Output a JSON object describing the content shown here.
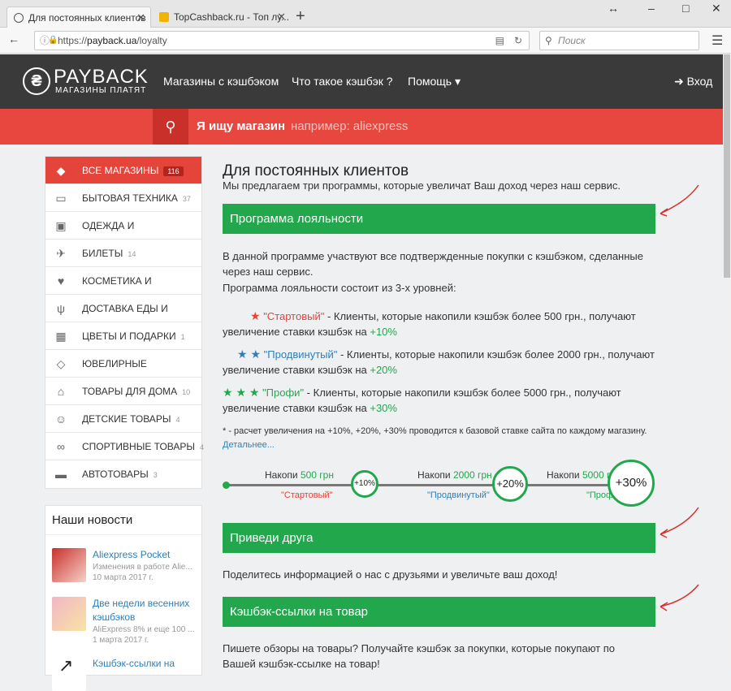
{
  "browser": {
    "tabs": [
      {
        "title": "Для постоянных клиентов",
        "close": "✕"
      },
      {
        "title": "TopCashback.ru - Топ лу...",
        "close": "✕"
      }
    ],
    "new_tab": "+",
    "url_scheme": "https://",
    "url_host": "payback.ua",
    "url_path": "/loyalty",
    "search_placeholder": "Поиск",
    "window_controls": [
      "↔",
      "–",
      "□",
      "✕"
    ]
  },
  "header": {
    "logo_name": "PAYBACK",
    "logo_tagline": "МАГАЗИНЫ ПЛАТЯТ",
    "menu": [
      "Магазины с кэшбэком",
      "Что такое кэшбэк ?",
      "Помощь ▾"
    ],
    "login": "Вход"
  },
  "search": {
    "label": "Я ищу магазин",
    "placeholder": "например: aliexpress"
  },
  "sidebar": {
    "categories": [
      {
        "label": "ВСЕ МАГАЗИНЫ",
        "count": "116",
        "icon": "tag-icon"
      },
      {
        "label": "БЫТОВАЯ ТЕХНИКА",
        "count": "37",
        "icon": "monitor-icon"
      },
      {
        "label": "ОДЕЖДА И",
        "count": "",
        "icon": "bag-icon"
      },
      {
        "label": "БИЛЕТЫ",
        "count": "14",
        "icon": "plane-icon"
      },
      {
        "label": "КОСМЕТИКА И",
        "count": "",
        "icon": "heart-icon"
      },
      {
        "label": "ДОСТАВКА ЕДЫ И",
        "count": "",
        "icon": "cutlery-icon"
      },
      {
        "label": "ЦВЕТЫ И ПОДАРКИ",
        "count": "1",
        "icon": "gift-icon"
      },
      {
        "label": "ЮВЕЛИРНЫЕ",
        "count": "",
        "icon": "diamond-icon"
      },
      {
        "label": "ТОВАРЫ ДЛЯ ДОМА",
        "count": "10",
        "icon": "home-icon"
      },
      {
        "label": "ДЕТСКИЕ ТОВАРЫ",
        "count": "4",
        "icon": "child-icon"
      },
      {
        "label": "СПОРТИВНЫЕ ТОВАРЫ",
        "count": "4",
        "icon": "bicycle-icon"
      },
      {
        "label": "АВТОТОВАРЫ",
        "count": "3",
        "icon": "car-icon"
      }
    ],
    "news_title": "Наши новости",
    "news": [
      {
        "title": "Aliexpress Pocket",
        "desc": "Изменения в работе Alie...",
        "date": "10 марта 2017 г."
      },
      {
        "title": "Две недели весенних кэшбэков",
        "desc": "AliExpress 8% и еще 100 ...",
        "date": "1 марта 2017 г."
      },
      {
        "title": "Кэшбэк-ссылки на",
        "desc": "",
        "date": ""
      }
    ]
  },
  "main": {
    "title": "Для постоянных клиентов",
    "intro": "Мы предлагаем три программы, которые увеличат Ваш доход через наш сервис.",
    "loyalty": {
      "heading": "Программа лояльности",
      "p1": "В данной программе участвуют все подтвержденные покупки с кэшбэком, сделанные через наш сервис.",
      "p2": "Программа лояльности состоит из 3-х уровней:",
      "levels": [
        {
          "stars": "★",
          "name": "\"Стартовый\"",
          "text": " - Клиенты, которые накопили кэшбэк более 500 грн., получают увеличение ставки кэшбэк на ",
          "rate": "+10%"
        },
        {
          "stars": "★ ★",
          "name": "\"Продвинутый\"",
          "text": " - Клиенты, которые накопили кэшбэк более 2000 грн., получают увеличение ставки кэшбэк на ",
          "rate": "+20%"
        },
        {
          "stars": "★ ★ ★",
          "name": "\"Профи\"",
          "text": " - Клиенты, которые накопили кэшбэк более 5000 грн., получают увеличение ставки кэшбэк на ",
          "rate": "+30%"
        }
      ],
      "note": "* - расчет увеличения на +10%, +20%, +30% проводится к базовой ставке сайта по каждому магазину.",
      "more": "Детальнее...",
      "track": [
        {
          "pre": "Накопи ",
          "amount": "500 грн",
          "circle": "+10%",
          "name": "\"Стартовый\""
        },
        {
          "pre": "Накопи ",
          "amount": "2000 грн",
          "circle": "+20%",
          "name": "\"Продвинутый\""
        },
        {
          "pre": "Накопи ",
          "amount": "5000 грн",
          "circle": "+30%",
          "name": "\"Профи\""
        }
      ]
    },
    "friend": {
      "heading": "Приведи друга",
      "text": "Поделитесь информацией о нас с друзьями и увеличьте ваш доход!"
    },
    "links": {
      "heading": "Кэшбэк-ссылки на товар",
      "text": "Пишете обзоры на товары? Получайте кэшбэк за покупки, которые покупают по Вашей кэшбэк-ссылке на товар!"
    }
  }
}
